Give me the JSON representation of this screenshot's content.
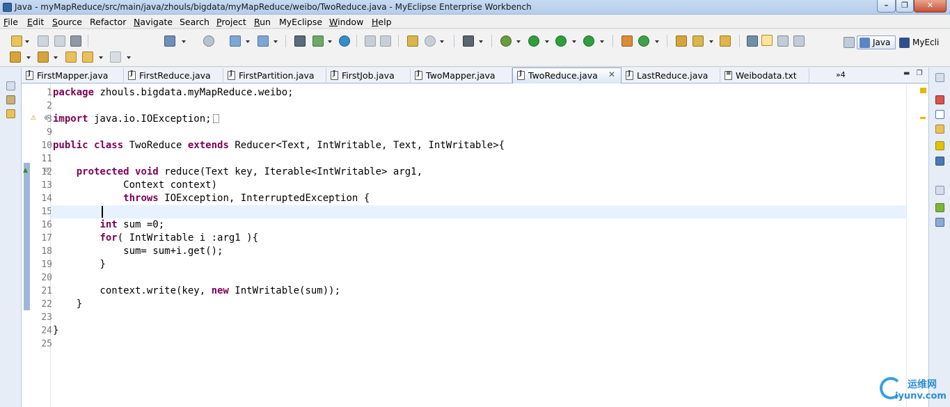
{
  "window": {
    "title": "Java - myMapReduce/src/main/java/zhouls/bigdata/myMapReduce/weibo/TwoReduce.java - MyEclipse Enterprise Workbench"
  },
  "menu": [
    {
      "label": "File",
      "mnemonic": "F",
      "rest": "ile"
    },
    {
      "label": "Edit",
      "mnemonic": "E",
      "rest": "dit"
    },
    {
      "label": "Source",
      "mnemonic": "S",
      "rest": "ource"
    },
    {
      "label": "Refactor",
      "mnemonic": "",
      "rest": "Refactor"
    },
    {
      "label": "Navigate",
      "mnemonic": "N",
      "rest": "avigate"
    },
    {
      "label": "Search",
      "mnemonic": "",
      "rest": "Search"
    },
    {
      "label": "Project",
      "mnemonic": "P",
      "rest": "roject"
    },
    {
      "label": "Run",
      "mnemonic": "R",
      "rest": "un"
    },
    {
      "label": "MyEclipse",
      "mnemonic": "",
      "rest": "MyEclipse"
    },
    {
      "label": "Window",
      "mnemonic": "W",
      "rest": "indow"
    },
    {
      "label": "Help",
      "mnemonic": "H",
      "rest": "elp"
    }
  ],
  "perspectives": {
    "java": "Java",
    "myeclipse": "MyEcli"
  },
  "tabs": [
    {
      "label": "FirstMapper.java",
      "active": false
    },
    {
      "label": "FirstReduce.java",
      "active": false
    },
    {
      "label": "FirstPartition.java",
      "active": false
    },
    {
      "label": "FirstJob.java",
      "active": false
    },
    {
      "label": "TwoMapper.java",
      "active": false
    },
    {
      "label": "TwoReduce.java",
      "active": true
    },
    {
      "label": "LastReduce.java",
      "active": false
    },
    {
      "label": "Weibodata.txt",
      "active": false
    }
  ],
  "tab_overflow": "»4",
  "editor": {
    "lines": [
      {
        "num": "1",
        "text": "package zhouls.bigdata.myMapReduce.weibo;"
      },
      {
        "num": "2",
        "text": ""
      },
      {
        "num": "3",
        "text": "import java.io.IOException;"
      },
      {
        "num": "9",
        "text": ""
      },
      {
        "num": "10",
        "text": "public class TwoReduce extends Reducer<Text, IntWritable, Text, IntWritable>{"
      },
      {
        "num": "11",
        "text": ""
      },
      {
        "num": "12",
        "text": "    protected void reduce(Text key, Iterable<IntWritable> arg1,"
      },
      {
        "num": "13",
        "text": "            Context context)"
      },
      {
        "num": "14",
        "text": "            throws IOException, InterruptedException {"
      },
      {
        "num": "15",
        "text": ""
      },
      {
        "num": "16",
        "text": "        int sum =0;"
      },
      {
        "num": "17",
        "text": "        for( IntWritable i :arg1 ){"
      },
      {
        "num": "18",
        "text": "            sum= sum+i.get();"
      },
      {
        "num": "19",
        "text": "        }"
      },
      {
        "num": "20",
        "text": ""
      },
      {
        "num": "21",
        "text": "        context.write(key, new IntWritable(sum));"
      },
      {
        "num": "22",
        "text": "    }"
      },
      {
        "num": "23",
        "text": ""
      },
      {
        "num": "24",
        "text": "}"
      },
      {
        "num": "25",
        "text": ""
      }
    ],
    "current_line": "15",
    "keywords": [
      "package",
      "import",
      "public",
      "class",
      "extends",
      "protected",
      "void",
      "throws",
      "int",
      "for",
      "new"
    ]
  },
  "watermark": {
    "cn": "运维网",
    "en": "iyunv.com"
  },
  "colors": {
    "keyword": "#7f0055",
    "current_line": "#e8f2fe",
    "change_bar": "#9fb7d6"
  }
}
